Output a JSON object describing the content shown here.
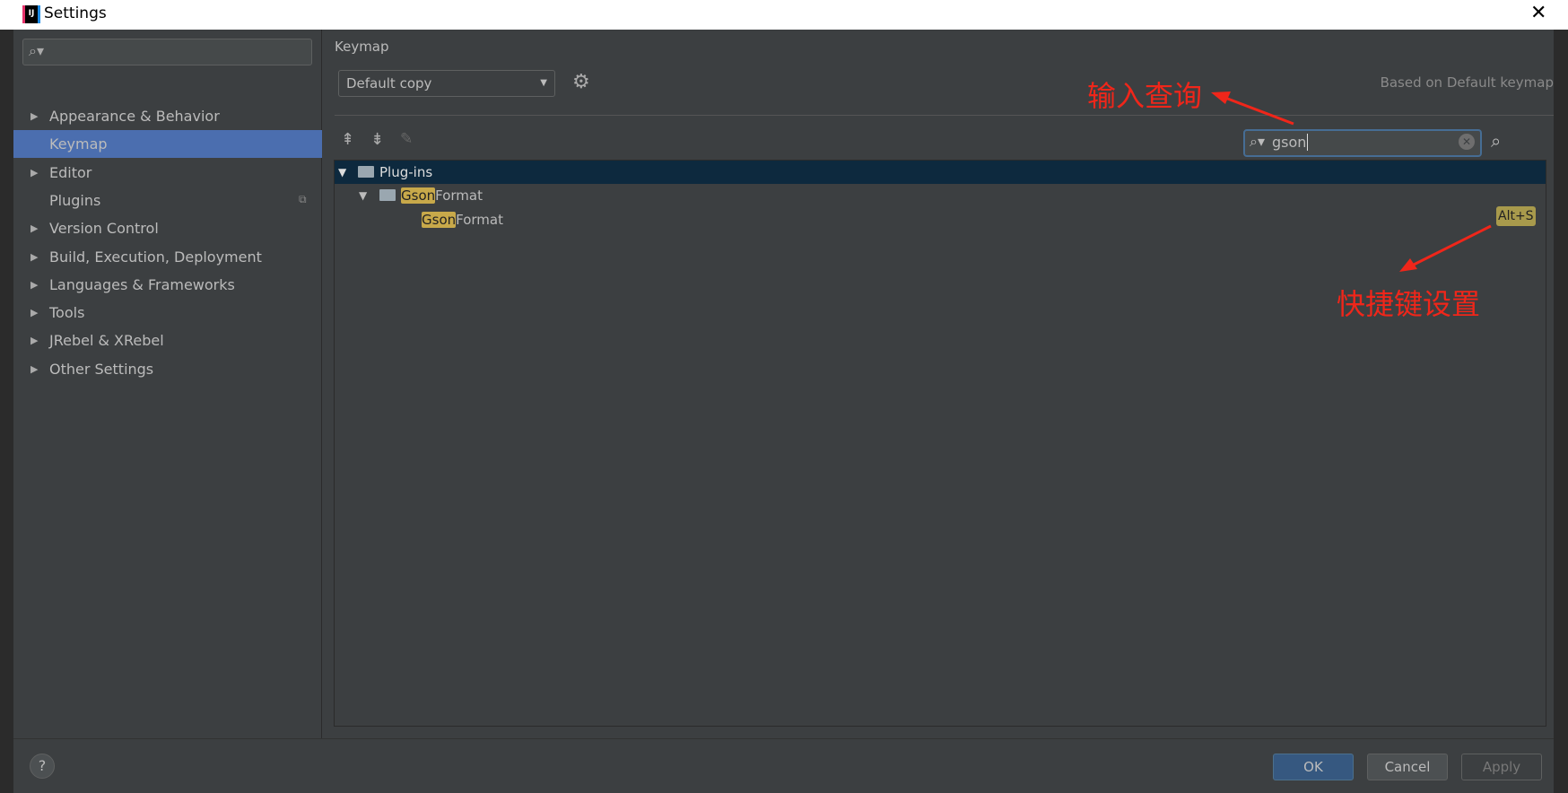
{
  "window": {
    "title": "Settings",
    "close_icon": "close-icon"
  },
  "sidebar": {
    "search_placeholder": "",
    "items": [
      {
        "label": "Appearance & Behavior",
        "expandable": true
      },
      {
        "label": "Keymap",
        "expandable": false,
        "selected": true
      },
      {
        "label": "Editor",
        "expandable": true
      },
      {
        "label": "Plugins",
        "expandable": false
      },
      {
        "label": "Version Control",
        "expandable": true
      },
      {
        "label": "Build, Execution, Deployment",
        "expandable": true
      },
      {
        "label": "Languages & Frameworks",
        "expandable": true
      },
      {
        "label": "Tools",
        "expandable": true
      },
      {
        "label": "JRebel & XRebel",
        "expandable": true
      },
      {
        "label": "Other Settings",
        "expandable": true
      }
    ]
  },
  "main": {
    "title": "Keymap",
    "keymap_select": "Default copy",
    "based_on": "Based on Default keymap",
    "search_value": "gson",
    "tree": {
      "root": "Plug-ins",
      "group_match": "Gson",
      "group_rest": "Format",
      "action_match": "Gson",
      "action_rest": "Format",
      "shortcut": "Alt+S"
    }
  },
  "annotations": {
    "search": "输入查询",
    "shortcut": "快捷键设置"
  },
  "buttons": {
    "help": "?",
    "ok": "OK",
    "cancel": "Cancel",
    "apply": "Apply"
  },
  "colors": {
    "selection": "#4b6eaf",
    "highlight": "#c8a94a",
    "annotation": "#f0261a"
  }
}
